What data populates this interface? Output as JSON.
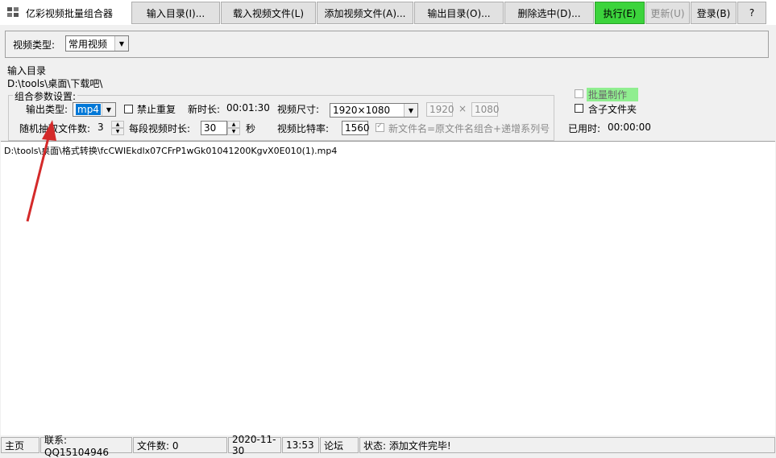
{
  "window": {
    "title": "亿彩视频批量组合器",
    "minimize": "—",
    "maximize": "☐",
    "close": "✕"
  },
  "toolbar": {
    "video_type_label": "视频类型:",
    "video_type_value": "常用视频",
    "input_dir": "输入目录(I)...",
    "load_files": "载入视频文件(L)",
    "add_files": "添加视频文件(A)...",
    "output_dir": "输出目录(O)...",
    "delete_selected": "删除选中(D)...",
    "execute": "执行(E)",
    "update": "更新(U)",
    "login": "登录(B)",
    "help": "?"
  },
  "input": {
    "label": "输入目录",
    "path": "D:\\tools\\桌面\\下载吧\\"
  },
  "params": {
    "group_title": "组合参数设置:",
    "output_type_label": "输出类型:",
    "output_type_value": "mp4",
    "no_repeat_label": "禁止重复",
    "new_duration_label": "新时长:",
    "new_duration_value": "00:01:30",
    "video_size_label": "视频尺寸:",
    "video_size_value": "1920×1080",
    "width_value": "1920",
    "times_sign": "×",
    "height_value": "1080",
    "random_count_label": "随机抽取文件数:",
    "random_count_value": "3",
    "segment_duration_label": "每段视频时长:",
    "segment_duration_value": "30",
    "seconds_unit": "秒",
    "bitrate_label": "视频比特率:",
    "bitrate_value": "1560",
    "naming_label": "新文件名=原文件名组合+递增系列号",
    "batch_label": "批量制作",
    "subfolder_label": "含子文件夹",
    "elapsed_label": "已用时:",
    "elapsed_value": "00:00:00"
  },
  "files": [
    "D:\\tools\\桌面\\格式转换\\fcCWIEkdlx07CFrP1wGk01041200KgvX0E010(1).mp4"
  ],
  "status": {
    "home": "主页",
    "contact": "联系:  QQ15104946",
    "file_count": "文件数:  0",
    "date": "2020-11-30",
    "time": "13:53",
    "forum": "论坛",
    "state": "状态:  添加文件完毕!"
  },
  "colors": {
    "execute_bg": "#3cd43c",
    "batch_highlight": "#90ee90",
    "arrow": "#d42a2a"
  }
}
